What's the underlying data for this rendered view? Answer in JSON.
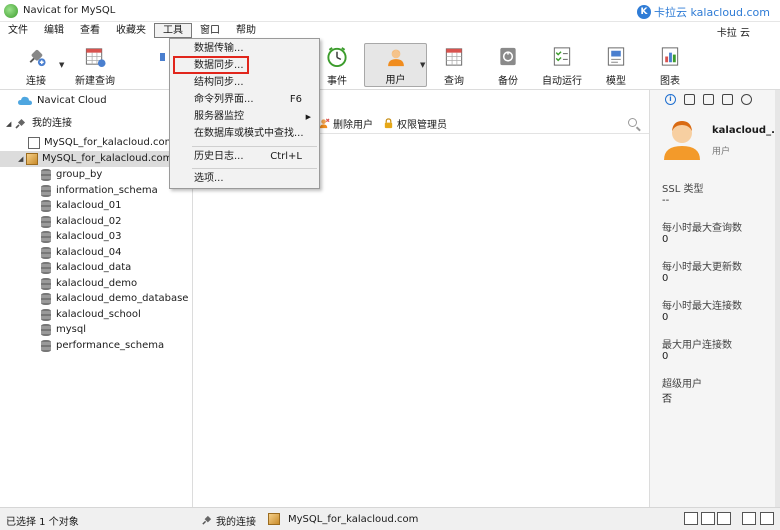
{
  "window": {
    "title": "Navicat for MySQL",
    "brand": "卡拉云 kalacloud.com",
    "brand_icon": "K"
  },
  "menubar": {
    "items": [
      "文件",
      "编辑",
      "查看",
      "收藏夹",
      "工具",
      "窗口",
      "帮助"
    ],
    "user": "卡拉 云"
  },
  "toolbar": {
    "connect": "连接",
    "new_query": "新建查询",
    "event": "事件",
    "user": "用户",
    "query": "查询",
    "backup": "备份",
    "autorun": "自动运行",
    "model": "模型",
    "chart": "图表"
  },
  "tree": {
    "cloud": "Navicat Cloud",
    "my_connections": "我的连接",
    "conn1": "MySQL_for_kalacloud.com",
    "conn2": "MySQL_for_kalacloud.com",
    "databases": [
      "group_by",
      "information_schema",
      "kalacloud_01",
      "kalacloud_02",
      "kalacloud_03",
      "kalacloud_04",
      "kalacloud_data",
      "kalacloud_demo",
      "kalacloud_demo_database",
      "kalacloud_school",
      "mysql",
      "performance_schema"
    ]
  },
  "objbar": {
    "delete_user": "删除用户",
    "privilege_manager": "权限管理员"
  },
  "tools_menu": {
    "data_transfer": "数据传输...",
    "data_sync": "数据同步...",
    "structure_sync": "结构同步...",
    "console": "命令列界面...",
    "console_shortcut": "F6",
    "server_monitor": "服务器监控",
    "find_in_db": "在数据库或模式中查找...",
    "history_log": "历史日志...",
    "history_shortcut": "Ctrl+L",
    "options": "选项..."
  },
  "info": {
    "name": "kalacloud_...",
    "type": "用户",
    "fields": [
      {
        "label": "SSL 类型",
        "value": "--"
      },
      {
        "label": "每小时最大查询数",
        "value": "0"
      },
      {
        "label": "每小时最大更新数",
        "value": "0"
      },
      {
        "label": "每小时最大连接数",
        "value": "0"
      },
      {
        "label": "最大用户连接数",
        "value": "0"
      },
      {
        "label": "超级用户",
        "value": "否"
      }
    ]
  },
  "status": {
    "selected": "已选择 1 个对象",
    "connection": "我的连接",
    "server": "MySQL_for_kalacloud.com"
  }
}
